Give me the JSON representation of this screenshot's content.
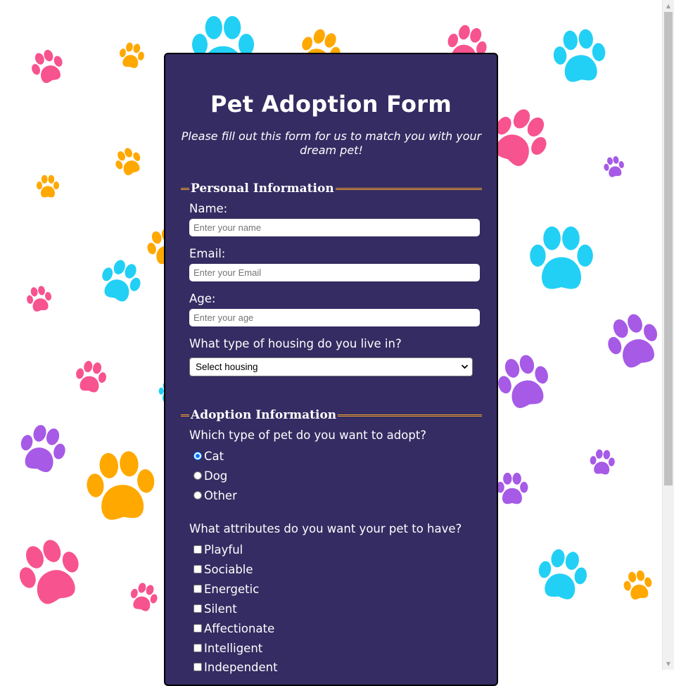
{
  "form": {
    "title": "Pet Adoption Form",
    "subtitle": "Please fill out this form for us to match you with your dream pet!"
  },
  "personal": {
    "legend": "Personal Information",
    "name_label": "Name:",
    "name_placeholder": "Enter your name",
    "email_label": "Email:",
    "email_placeholder": "Enter your Email",
    "age_label": "Age:",
    "age_placeholder": "Enter your age",
    "housing_label": "What type of housing do you live in?",
    "housing_selected": "Select housing"
  },
  "adoption": {
    "legend": "Adoption Information",
    "pet_type_label": "Which type of pet do you want to adopt?",
    "pet_types": [
      {
        "label": "Cat",
        "checked": true
      },
      {
        "label": "Dog",
        "checked": false
      },
      {
        "label": "Other",
        "checked": false
      }
    ],
    "attributes_label": "What attributes do you want your pet to have?",
    "attributes": [
      "Playful",
      "Sociable",
      "Energetic",
      "Silent",
      "Affectionate",
      "Intelligent",
      "Independent"
    ]
  },
  "colors": {
    "card_background": "#342c62",
    "legend_line": "#f2a12e",
    "paw_pink": "#f7538f",
    "paw_blue": "#22d0f5",
    "paw_orange": "#ffa800",
    "paw_purple": "#a65ae6"
  }
}
